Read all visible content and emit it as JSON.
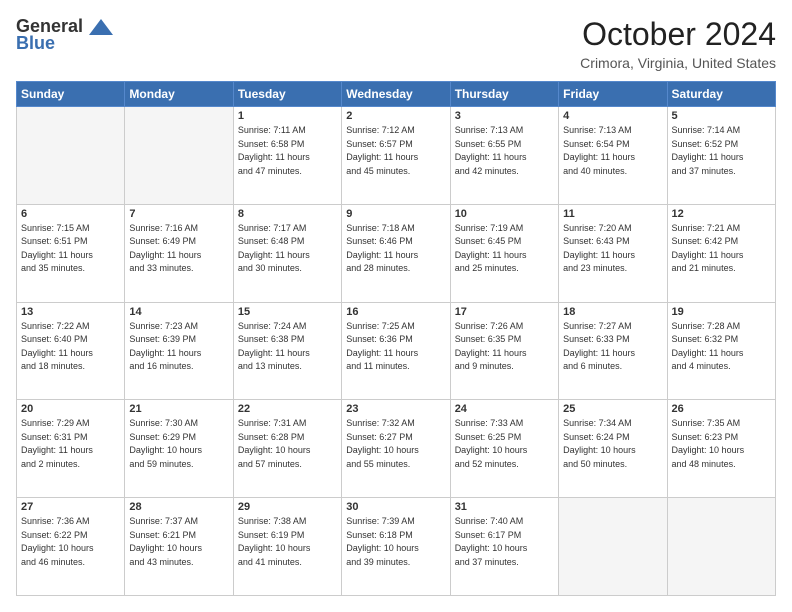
{
  "header": {
    "logo_line1": "General",
    "logo_line2": "Blue",
    "month_title": "October 2024",
    "location": "Crimora, Virginia, United States"
  },
  "days_of_week": [
    "Sunday",
    "Monday",
    "Tuesday",
    "Wednesday",
    "Thursday",
    "Friday",
    "Saturday"
  ],
  "weeks": [
    [
      {
        "day": "",
        "info": ""
      },
      {
        "day": "",
        "info": ""
      },
      {
        "day": "1",
        "info": "Sunrise: 7:11 AM\nSunset: 6:58 PM\nDaylight: 11 hours\nand 47 minutes."
      },
      {
        "day": "2",
        "info": "Sunrise: 7:12 AM\nSunset: 6:57 PM\nDaylight: 11 hours\nand 45 minutes."
      },
      {
        "day": "3",
        "info": "Sunrise: 7:13 AM\nSunset: 6:55 PM\nDaylight: 11 hours\nand 42 minutes."
      },
      {
        "day": "4",
        "info": "Sunrise: 7:13 AM\nSunset: 6:54 PM\nDaylight: 11 hours\nand 40 minutes."
      },
      {
        "day": "5",
        "info": "Sunrise: 7:14 AM\nSunset: 6:52 PM\nDaylight: 11 hours\nand 37 minutes."
      }
    ],
    [
      {
        "day": "6",
        "info": "Sunrise: 7:15 AM\nSunset: 6:51 PM\nDaylight: 11 hours\nand 35 minutes."
      },
      {
        "day": "7",
        "info": "Sunrise: 7:16 AM\nSunset: 6:49 PM\nDaylight: 11 hours\nand 33 minutes."
      },
      {
        "day": "8",
        "info": "Sunrise: 7:17 AM\nSunset: 6:48 PM\nDaylight: 11 hours\nand 30 minutes."
      },
      {
        "day": "9",
        "info": "Sunrise: 7:18 AM\nSunset: 6:46 PM\nDaylight: 11 hours\nand 28 minutes."
      },
      {
        "day": "10",
        "info": "Sunrise: 7:19 AM\nSunset: 6:45 PM\nDaylight: 11 hours\nand 25 minutes."
      },
      {
        "day": "11",
        "info": "Sunrise: 7:20 AM\nSunset: 6:43 PM\nDaylight: 11 hours\nand 23 minutes."
      },
      {
        "day": "12",
        "info": "Sunrise: 7:21 AM\nSunset: 6:42 PM\nDaylight: 11 hours\nand 21 minutes."
      }
    ],
    [
      {
        "day": "13",
        "info": "Sunrise: 7:22 AM\nSunset: 6:40 PM\nDaylight: 11 hours\nand 18 minutes."
      },
      {
        "day": "14",
        "info": "Sunrise: 7:23 AM\nSunset: 6:39 PM\nDaylight: 11 hours\nand 16 minutes."
      },
      {
        "day": "15",
        "info": "Sunrise: 7:24 AM\nSunset: 6:38 PM\nDaylight: 11 hours\nand 13 minutes."
      },
      {
        "day": "16",
        "info": "Sunrise: 7:25 AM\nSunset: 6:36 PM\nDaylight: 11 hours\nand 11 minutes."
      },
      {
        "day": "17",
        "info": "Sunrise: 7:26 AM\nSunset: 6:35 PM\nDaylight: 11 hours\nand 9 minutes."
      },
      {
        "day": "18",
        "info": "Sunrise: 7:27 AM\nSunset: 6:33 PM\nDaylight: 11 hours\nand 6 minutes."
      },
      {
        "day": "19",
        "info": "Sunrise: 7:28 AM\nSunset: 6:32 PM\nDaylight: 11 hours\nand 4 minutes."
      }
    ],
    [
      {
        "day": "20",
        "info": "Sunrise: 7:29 AM\nSunset: 6:31 PM\nDaylight: 11 hours\nand 2 minutes."
      },
      {
        "day": "21",
        "info": "Sunrise: 7:30 AM\nSunset: 6:29 PM\nDaylight: 10 hours\nand 59 minutes."
      },
      {
        "day": "22",
        "info": "Sunrise: 7:31 AM\nSunset: 6:28 PM\nDaylight: 10 hours\nand 57 minutes."
      },
      {
        "day": "23",
        "info": "Sunrise: 7:32 AM\nSunset: 6:27 PM\nDaylight: 10 hours\nand 55 minutes."
      },
      {
        "day": "24",
        "info": "Sunrise: 7:33 AM\nSunset: 6:25 PM\nDaylight: 10 hours\nand 52 minutes."
      },
      {
        "day": "25",
        "info": "Sunrise: 7:34 AM\nSunset: 6:24 PM\nDaylight: 10 hours\nand 50 minutes."
      },
      {
        "day": "26",
        "info": "Sunrise: 7:35 AM\nSunset: 6:23 PM\nDaylight: 10 hours\nand 48 minutes."
      }
    ],
    [
      {
        "day": "27",
        "info": "Sunrise: 7:36 AM\nSunset: 6:22 PM\nDaylight: 10 hours\nand 46 minutes."
      },
      {
        "day": "28",
        "info": "Sunrise: 7:37 AM\nSunset: 6:21 PM\nDaylight: 10 hours\nand 43 minutes."
      },
      {
        "day": "29",
        "info": "Sunrise: 7:38 AM\nSunset: 6:19 PM\nDaylight: 10 hours\nand 41 minutes."
      },
      {
        "day": "30",
        "info": "Sunrise: 7:39 AM\nSunset: 6:18 PM\nDaylight: 10 hours\nand 39 minutes."
      },
      {
        "day": "31",
        "info": "Sunrise: 7:40 AM\nSunset: 6:17 PM\nDaylight: 10 hours\nand 37 minutes."
      },
      {
        "day": "",
        "info": ""
      },
      {
        "day": "",
        "info": ""
      }
    ]
  ]
}
